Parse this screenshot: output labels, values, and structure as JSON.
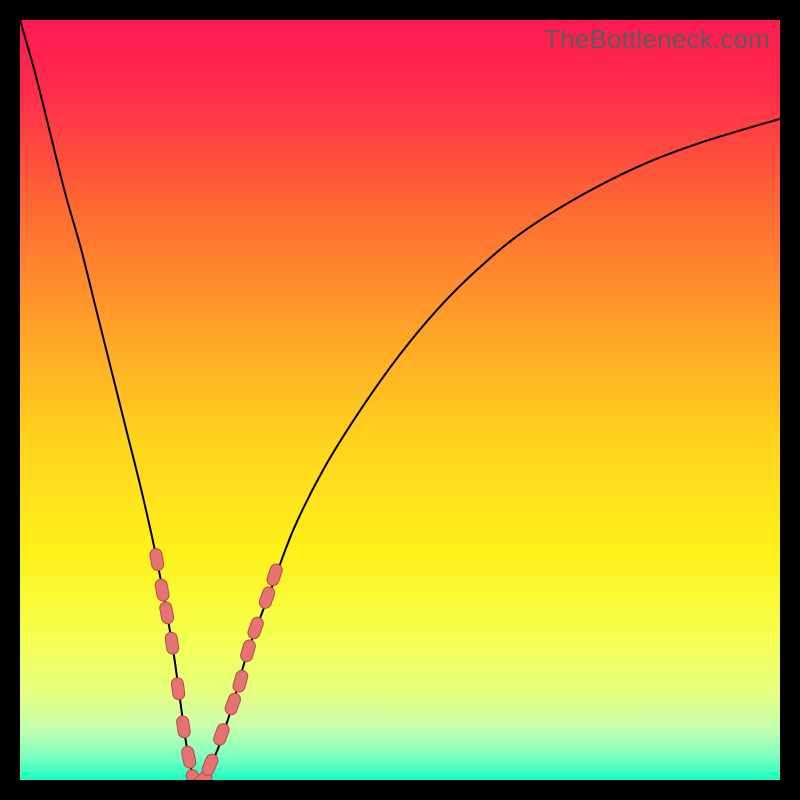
{
  "watermark": "TheBottleneck.com",
  "colors": {
    "black": "#000000",
    "curve": "#000000",
    "marker_fill": "#e57373",
    "marker_stroke": "#b24b4b",
    "gradient_stops": [
      {
        "offset": 0.0,
        "color": "#ff1a52"
      },
      {
        "offset": 0.1,
        "color": "#ff2e4a"
      },
      {
        "offset": 0.25,
        "color": "#ff6a32"
      },
      {
        "offset": 0.4,
        "color": "#ffa028"
      },
      {
        "offset": 0.55,
        "color": "#ffd21e"
      },
      {
        "offset": 0.7,
        "color": "#fff11a"
      },
      {
        "offset": 0.8,
        "color": "#f5ff4a"
      },
      {
        "offset": 0.88,
        "color": "#e8ff7a"
      },
      {
        "offset": 0.93,
        "color": "#c8ffad"
      },
      {
        "offset": 0.97,
        "color": "#7dffc0"
      },
      {
        "offset": 1.0,
        "color": "#19ffc1"
      }
    ]
  },
  "chart_data": {
    "type": "line",
    "title": "",
    "xlabel": "",
    "ylabel": "",
    "xlim": [
      0,
      100
    ],
    "ylim": [
      0,
      100
    ],
    "series": [
      {
        "name": "bottleneck-curve",
        "x": [
          0,
          2,
          4,
          6,
          8,
          10,
          12,
          14,
          16,
          18,
          20,
          21,
          22,
          23,
          24,
          26,
          28,
          30,
          33,
          36,
          40,
          45,
          50,
          55,
          60,
          66,
          74,
          82,
          90,
          100
        ],
        "values": [
          100,
          93,
          85,
          77,
          70,
          62,
          54,
          46,
          38,
          29,
          18,
          11,
          4,
          0,
          0,
          4,
          10,
          17,
          25,
          33,
          41,
          49,
          56,
          62,
          67,
          72,
          77,
          81,
          84,
          87
        ]
      }
    ],
    "markers": {
      "name": "highlighted-points",
      "points": [
        {
          "x": 18.0,
          "y": 29
        },
        {
          "x": 18.7,
          "y": 25
        },
        {
          "x": 19.3,
          "y": 22
        },
        {
          "x": 20.0,
          "y": 18
        },
        {
          "x": 20.8,
          "y": 12
        },
        {
          "x": 21.5,
          "y": 7
        },
        {
          "x": 22.2,
          "y": 3
        },
        {
          "x": 23.0,
          "y": 0
        },
        {
          "x": 24.0,
          "y": 0
        },
        {
          "x": 25.0,
          "y": 2
        },
        {
          "x": 26.5,
          "y": 6
        },
        {
          "x": 28.0,
          "y": 10
        },
        {
          "x": 29.0,
          "y": 13
        },
        {
          "x": 30.0,
          "y": 17
        },
        {
          "x": 31.0,
          "y": 20
        },
        {
          "x": 32.5,
          "y": 24
        },
        {
          "x": 33.5,
          "y": 27
        }
      ]
    }
  }
}
